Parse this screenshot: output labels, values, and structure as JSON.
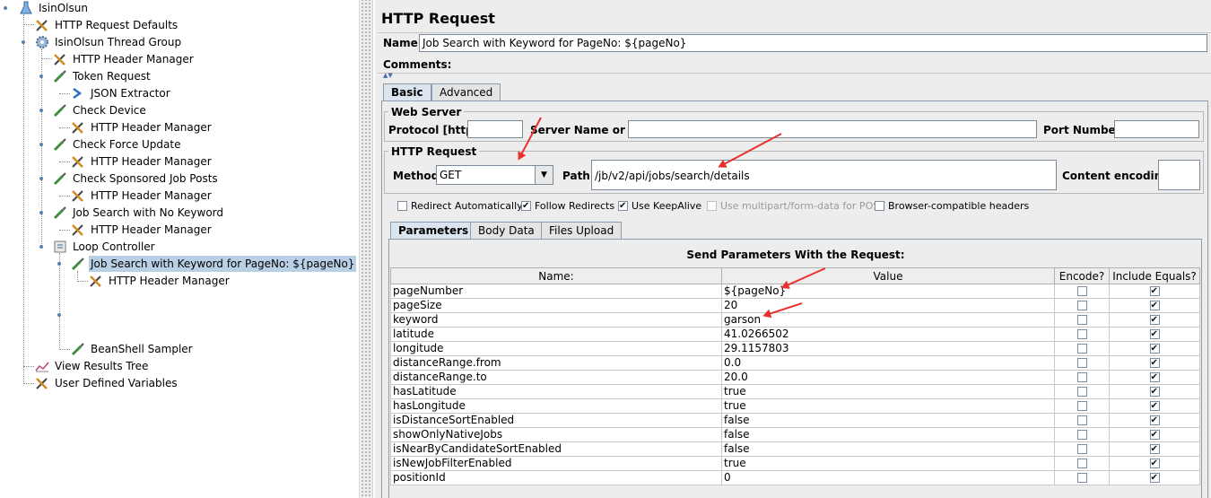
{
  "tree": {
    "items": [
      {
        "label": "IsinOlsun",
        "icon": "test-plan-flask-icon"
      },
      {
        "label": "HTTP Request Defaults",
        "icon": "wrench-config-icon"
      },
      {
        "label": "IsinOlsun Thread Group",
        "icon": "gear-thread-group-icon"
      },
      {
        "label": "HTTP Header Manager",
        "icon": "wrench-config-icon"
      },
      {
        "label": "Token Request",
        "icon": "pipette-sampler-icon"
      },
      {
        "label": "JSON Extractor",
        "icon": "arrow-extractor-icon"
      },
      {
        "label": "Check Device",
        "icon": "pipette-sampler-icon"
      },
      {
        "label": "HTTP Header Manager",
        "icon": "wrench-config-icon"
      },
      {
        "label": "Check Force Update",
        "icon": "pipette-sampler-icon"
      },
      {
        "label": "HTTP Header Manager",
        "icon": "wrench-config-icon"
      },
      {
        "label": "Check Sponsored Job Posts",
        "icon": "pipette-sampler-icon"
      },
      {
        "label": "HTTP Header Manager",
        "icon": "wrench-config-icon"
      },
      {
        "label": "Job Search with No Keyword",
        "icon": "pipette-sampler-icon"
      },
      {
        "label": "HTTP Header Manager",
        "icon": "wrench-config-icon"
      },
      {
        "label": "Loop Controller",
        "icon": "loop-controller-icon"
      },
      {
        "label": "Job Search with Keyword for PageNo: ${pageNo}",
        "icon": "pipette-sampler-icon",
        "selected": true
      },
      {
        "label": "HTTP Header Manager",
        "icon": "wrench-config-icon"
      },
      {
        "label": "BeanShell Sampler",
        "icon": "pipette-sampler-icon"
      },
      {
        "label": "View Results Tree",
        "icon": "graph-listener-icon"
      },
      {
        "label": "User Defined Variables",
        "icon": "wrench-config-icon"
      }
    ]
  },
  "panel": {
    "title": "HTTP Request",
    "name_label": "Name:",
    "name_value": "Job Search with Keyword for PageNo: ${pageNo}",
    "comments_label": "Comments:",
    "tabs": [
      "Basic",
      "Advanced"
    ],
    "web_server": {
      "title": "Web Server",
      "protocol_label": "Protocol [http]:",
      "protocol_value": "",
      "server_label": "Server Name or IP:",
      "server_value": "",
      "port_label": "Port Number:",
      "port_value": ""
    },
    "http_request": {
      "title": "HTTP Request",
      "method_label": "Method:",
      "method_value": "GET",
      "path_label": "Path:",
      "path_value": "/jb/v2/api/jobs/search/details",
      "encoding_label": "Content encoding:",
      "encoding_value": ""
    },
    "options": [
      {
        "label": "Redirect Automatically",
        "checked": false,
        "disabled": false
      },
      {
        "label": "Follow Redirects",
        "checked": true,
        "disabled": false
      },
      {
        "label": "Use KeepAlive",
        "checked": true,
        "disabled": false
      },
      {
        "label": "Use multipart/form-data for POST",
        "checked": false,
        "disabled": true
      },
      {
        "label": "Browser-compatible headers",
        "checked": false,
        "disabled": false
      }
    ],
    "subtabs": [
      "Parameters",
      "Body Data",
      "Files Upload"
    ],
    "params_heading": "Send Parameters With the Request:",
    "columns": [
      "Name:",
      "Value",
      "Encode?",
      "Include Equals?"
    ],
    "rows": [
      {
        "name": "pageNumber",
        "value": "${pageNo}",
        "encode": false,
        "equals": true
      },
      {
        "name": "pageSize",
        "value": "20",
        "encode": false,
        "equals": true
      },
      {
        "name": "keyword",
        "value": "garson",
        "encode": false,
        "equals": true
      },
      {
        "name": "latitude",
        "value": "41.0266502",
        "encode": false,
        "equals": true
      },
      {
        "name": "longitude",
        "value": "29.1157803",
        "encode": false,
        "equals": true
      },
      {
        "name": "distanceRange.from",
        "value": "0.0",
        "encode": false,
        "equals": true
      },
      {
        "name": "distanceRange.to",
        "value": "20.0",
        "encode": false,
        "equals": true
      },
      {
        "name": "hasLatitude",
        "value": "true",
        "encode": false,
        "equals": true
      },
      {
        "name": "hasLongitude",
        "value": "true",
        "encode": false,
        "equals": true
      },
      {
        "name": "isDistanceSortEnabled",
        "value": "false",
        "encode": false,
        "equals": true
      },
      {
        "name": "showOnlyNativeJobs",
        "value": "false",
        "encode": false,
        "equals": true
      },
      {
        "name": "isNearByCandidateSortEnabled",
        "value": "false",
        "encode": false,
        "equals": true
      },
      {
        "name": "isNewJobFilterEnabled",
        "value": "true",
        "encode": false,
        "equals": true
      },
      {
        "name": "positionId",
        "value": "0",
        "encode": false,
        "equals": true
      }
    ]
  },
  "colors": {
    "selection": "#b8cfe5",
    "annotation_arrow": "#e8312f",
    "panel_bg": "#ededed"
  }
}
